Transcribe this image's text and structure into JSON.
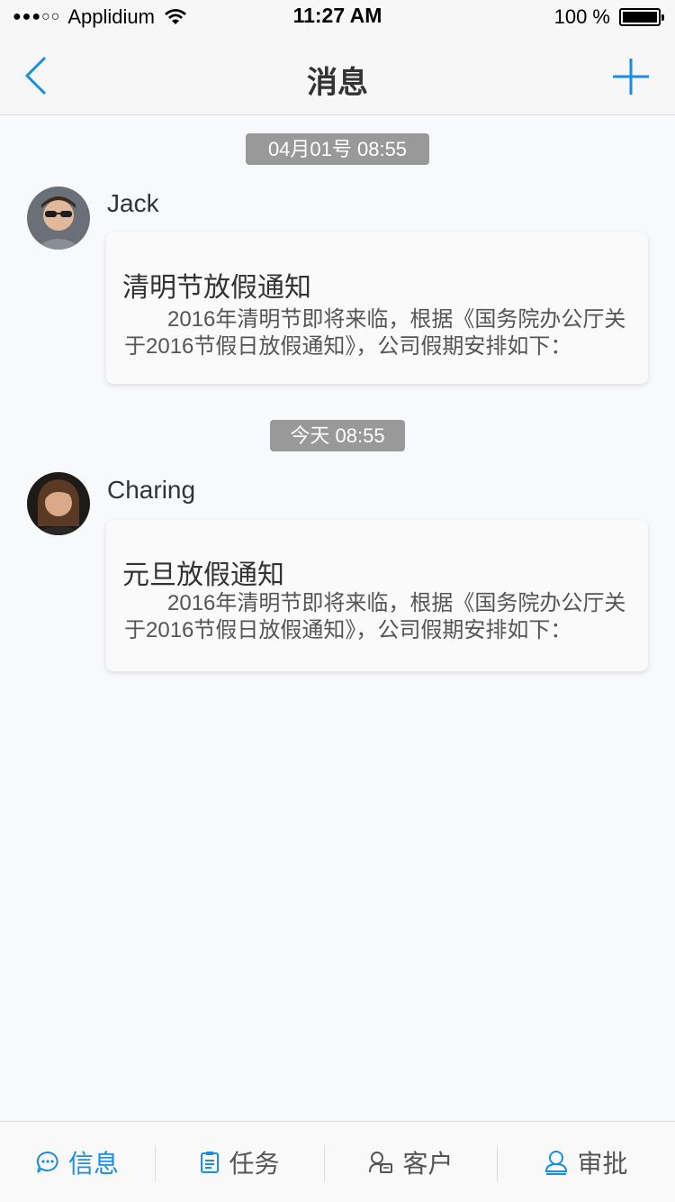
{
  "status_bar": {
    "signal": "●●●○○",
    "carrier": "Applidium",
    "time": "11:27 AM",
    "battery": "100 %"
  },
  "nav": {
    "title": "消息"
  },
  "messages": [
    {
      "time": "04月01号   08:55",
      "sender": "Jack",
      "title": "清明节放假通知",
      "body": "2016年清明节即将来临，根据《国务院办公厅关于2016节假日放假通知》，公司假期安排如下："
    },
    {
      "time": "今天   08:55",
      "sender": "Charing",
      "title": "元旦放假通知",
      "body": "2016年清明节即将来临，根据《国务院办公厅关于2016节假日放假通知》，公司假期安排如下："
    }
  ],
  "tabs": [
    {
      "label": "信息",
      "icon": "chat-bubble-icon",
      "active": true
    },
    {
      "label": "任务",
      "icon": "clipboard-icon",
      "active": false
    },
    {
      "label": "客户",
      "icon": "contact-card-icon",
      "active": false
    },
    {
      "label": "审批",
      "icon": "person-approve-icon",
      "active": false
    }
  ],
  "colors": {
    "accent": "#1a8ee1",
    "text": "#333333",
    "pill": "#999999",
    "background": "#f8f9fc"
  }
}
